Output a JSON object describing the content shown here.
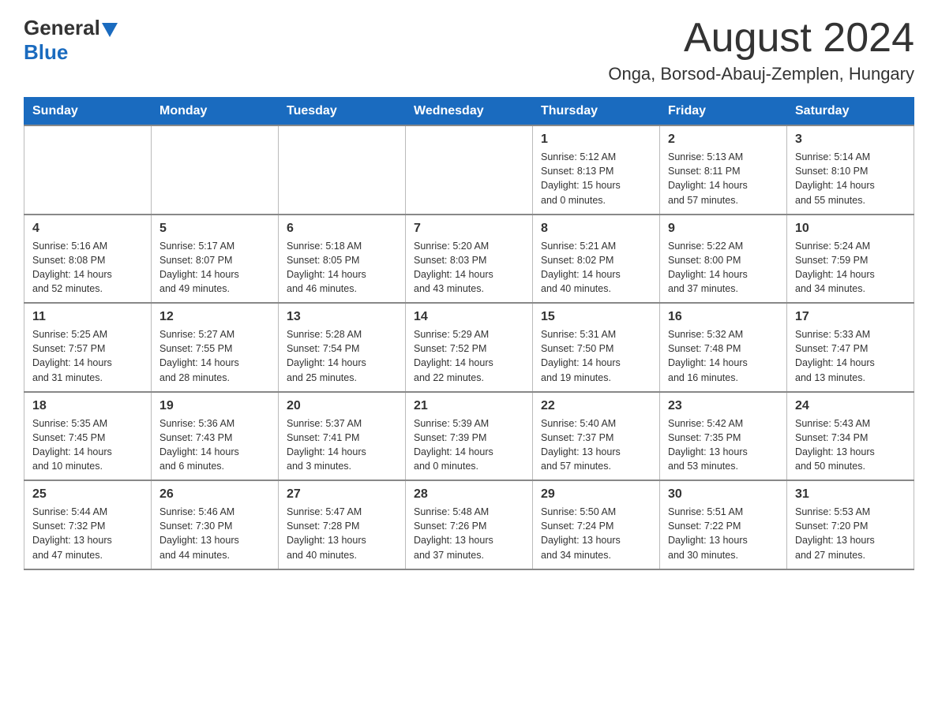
{
  "header": {
    "logo_general": "General",
    "logo_blue": "Blue",
    "month_title": "August 2024",
    "location": "Onga, Borsod-Abauj-Zemplen, Hungary"
  },
  "days_of_week": [
    "Sunday",
    "Monday",
    "Tuesday",
    "Wednesday",
    "Thursday",
    "Friday",
    "Saturday"
  ],
  "weeks": [
    {
      "days": [
        {
          "num": "",
          "info": ""
        },
        {
          "num": "",
          "info": ""
        },
        {
          "num": "",
          "info": ""
        },
        {
          "num": "",
          "info": ""
        },
        {
          "num": "1",
          "info": "Sunrise: 5:12 AM\nSunset: 8:13 PM\nDaylight: 15 hours\nand 0 minutes."
        },
        {
          "num": "2",
          "info": "Sunrise: 5:13 AM\nSunset: 8:11 PM\nDaylight: 14 hours\nand 57 minutes."
        },
        {
          "num": "3",
          "info": "Sunrise: 5:14 AM\nSunset: 8:10 PM\nDaylight: 14 hours\nand 55 minutes."
        }
      ]
    },
    {
      "days": [
        {
          "num": "4",
          "info": "Sunrise: 5:16 AM\nSunset: 8:08 PM\nDaylight: 14 hours\nand 52 minutes."
        },
        {
          "num": "5",
          "info": "Sunrise: 5:17 AM\nSunset: 8:07 PM\nDaylight: 14 hours\nand 49 minutes."
        },
        {
          "num": "6",
          "info": "Sunrise: 5:18 AM\nSunset: 8:05 PM\nDaylight: 14 hours\nand 46 minutes."
        },
        {
          "num": "7",
          "info": "Sunrise: 5:20 AM\nSunset: 8:03 PM\nDaylight: 14 hours\nand 43 minutes."
        },
        {
          "num": "8",
          "info": "Sunrise: 5:21 AM\nSunset: 8:02 PM\nDaylight: 14 hours\nand 40 minutes."
        },
        {
          "num": "9",
          "info": "Sunrise: 5:22 AM\nSunset: 8:00 PM\nDaylight: 14 hours\nand 37 minutes."
        },
        {
          "num": "10",
          "info": "Sunrise: 5:24 AM\nSunset: 7:59 PM\nDaylight: 14 hours\nand 34 minutes."
        }
      ]
    },
    {
      "days": [
        {
          "num": "11",
          "info": "Sunrise: 5:25 AM\nSunset: 7:57 PM\nDaylight: 14 hours\nand 31 minutes."
        },
        {
          "num": "12",
          "info": "Sunrise: 5:27 AM\nSunset: 7:55 PM\nDaylight: 14 hours\nand 28 minutes."
        },
        {
          "num": "13",
          "info": "Sunrise: 5:28 AM\nSunset: 7:54 PM\nDaylight: 14 hours\nand 25 minutes."
        },
        {
          "num": "14",
          "info": "Sunrise: 5:29 AM\nSunset: 7:52 PM\nDaylight: 14 hours\nand 22 minutes."
        },
        {
          "num": "15",
          "info": "Sunrise: 5:31 AM\nSunset: 7:50 PM\nDaylight: 14 hours\nand 19 minutes."
        },
        {
          "num": "16",
          "info": "Sunrise: 5:32 AM\nSunset: 7:48 PM\nDaylight: 14 hours\nand 16 minutes."
        },
        {
          "num": "17",
          "info": "Sunrise: 5:33 AM\nSunset: 7:47 PM\nDaylight: 14 hours\nand 13 minutes."
        }
      ]
    },
    {
      "days": [
        {
          "num": "18",
          "info": "Sunrise: 5:35 AM\nSunset: 7:45 PM\nDaylight: 14 hours\nand 10 minutes."
        },
        {
          "num": "19",
          "info": "Sunrise: 5:36 AM\nSunset: 7:43 PM\nDaylight: 14 hours\nand 6 minutes."
        },
        {
          "num": "20",
          "info": "Sunrise: 5:37 AM\nSunset: 7:41 PM\nDaylight: 14 hours\nand 3 minutes."
        },
        {
          "num": "21",
          "info": "Sunrise: 5:39 AM\nSunset: 7:39 PM\nDaylight: 14 hours\nand 0 minutes."
        },
        {
          "num": "22",
          "info": "Sunrise: 5:40 AM\nSunset: 7:37 PM\nDaylight: 13 hours\nand 57 minutes."
        },
        {
          "num": "23",
          "info": "Sunrise: 5:42 AM\nSunset: 7:35 PM\nDaylight: 13 hours\nand 53 minutes."
        },
        {
          "num": "24",
          "info": "Sunrise: 5:43 AM\nSunset: 7:34 PM\nDaylight: 13 hours\nand 50 minutes."
        }
      ]
    },
    {
      "days": [
        {
          "num": "25",
          "info": "Sunrise: 5:44 AM\nSunset: 7:32 PM\nDaylight: 13 hours\nand 47 minutes."
        },
        {
          "num": "26",
          "info": "Sunrise: 5:46 AM\nSunset: 7:30 PM\nDaylight: 13 hours\nand 44 minutes."
        },
        {
          "num": "27",
          "info": "Sunrise: 5:47 AM\nSunset: 7:28 PM\nDaylight: 13 hours\nand 40 minutes."
        },
        {
          "num": "28",
          "info": "Sunrise: 5:48 AM\nSunset: 7:26 PM\nDaylight: 13 hours\nand 37 minutes."
        },
        {
          "num": "29",
          "info": "Sunrise: 5:50 AM\nSunset: 7:24 PM\nDaylight: 13 hours\nand 34 minutes."
        },
        {
          "num": "30",
          "info": "Sunrise: 5:51 AM\nSunset: 7:22 PM\nDaylight: 13 hours\nand 30 minutes."
        },
        {
          "num": "31",
          "info": "Sunrise: 5:53 AM\nSunset: 7:20 PM\nDaylight: 13 hours\nand 27 minutes."
        }
      ]
    }
  ]
}
